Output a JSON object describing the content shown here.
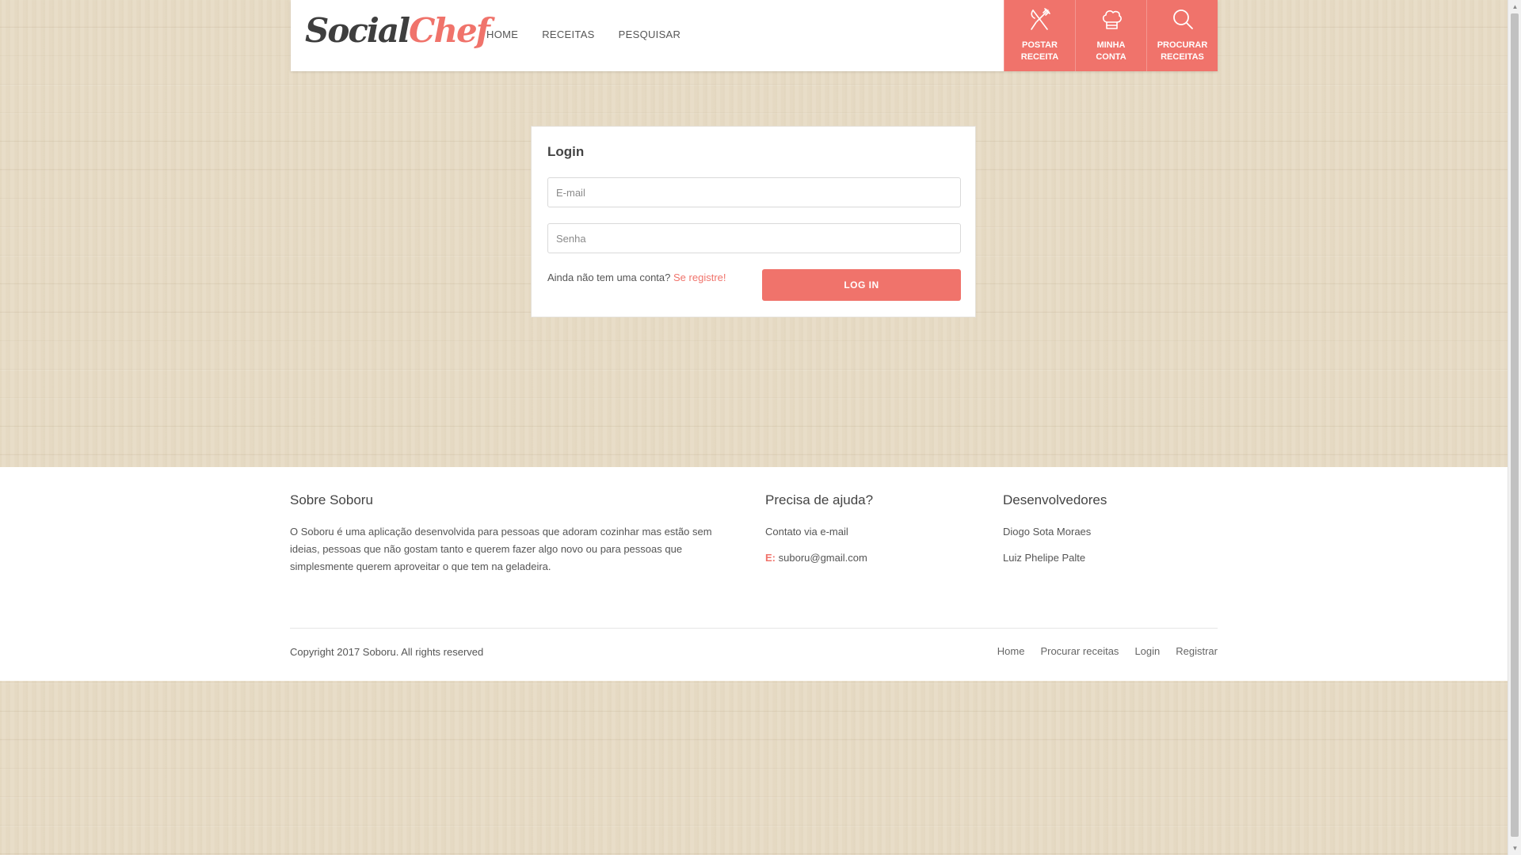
{
  "brand": {
    "logo_part1": "Social",
    "logo_part2": "Chef"
  },
  "nav": {
    "home": "HOME",
    "recipes": "RECEITAS",
    "search": "PESQUISAR"
  },
  "actions": [
    {
      "label_line1": "POSTAR",
      "label_line2": "RECEITA",
      "icon": "fork-knife-icon"
    },
    {
      "label_line1": "MINHA",
      "label_line2": "CONTA",
      "icon": "chef-hat-icon"
    },
    {
      "label_line1": "PROCURAR",
      "label_line2": "RECEITAS",
      "icon": "search-icon"
    }
  ],
  "login": {
    "title": "Login",
    "email_placeholder": "E-mail",
    "email_value": "",
    "password_placeholder": "Senha",
    "password_value": "",
    "register_prompt": "Ainda não tem uma conta?",
    "register_link": "Se registre!",
    "submit_label": "LOG IN"
  },
  "footer": {
    "about": {
      "title": "Sobre Soboru",
      "text": "O Soboru é uma aplicação desenvolvida para pessoas que adoram cozinhar mas estão sem ideias, pessoas que não gostam tanto e querem fazer algo novo ou para pessoas que simplesmente querem aproveitar o que tem na geladeira."
    },
    "help": {
      "title": "Precisa de ajuda?",
      "contact": "Contato via e-mail",
      "email_label": "E:",
      "email": "suboru@gmail.com"
    },
    "devs": {
      "title": "Desenvolvedores",
      "dev1": "Diogo Sota Moraes",
      "dev2": "Luiz Phelipe Palte"
    },
    "copyright": "Copyright 2017 Soboru. All rights reserved",
    "links": {
      "home": "Home",
      "search_recipes": "Procurar receitas",
      "login": "Login",
      "register": "Registrar"
    }
  },
  "colors": {
    "accent": "#f0736b",
    "text": "#555555",
    "card": "#ffffff"
  }
}
